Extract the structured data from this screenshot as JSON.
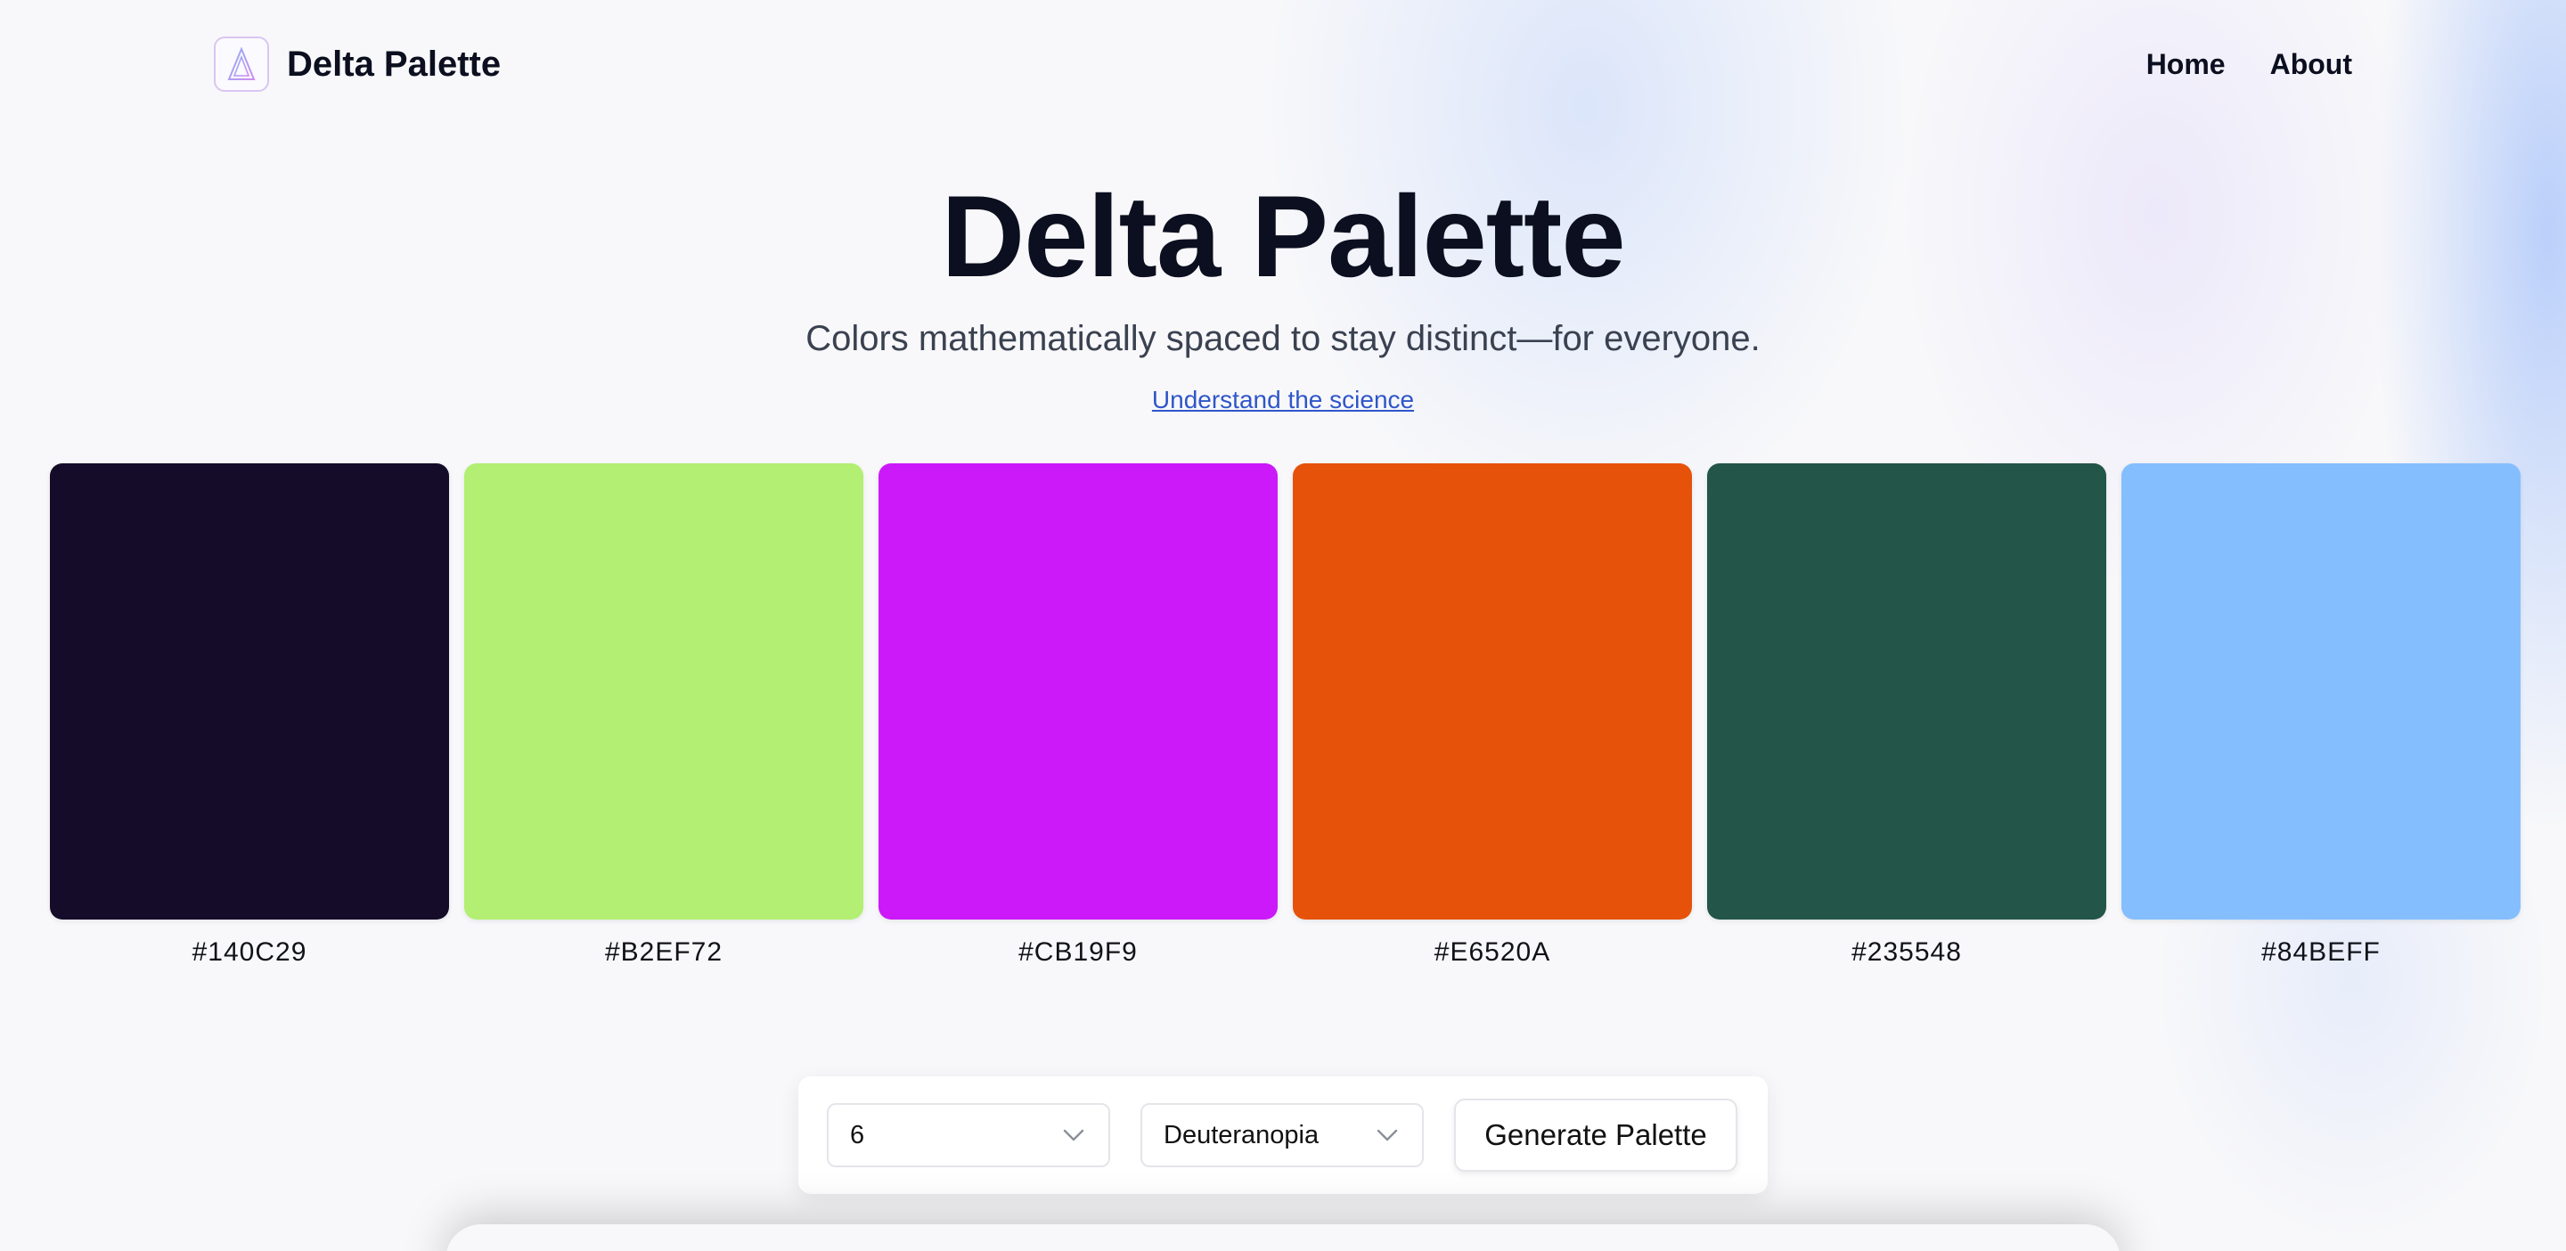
{
  "header": {
    "brand_name": "Delta Palette",
    "logo_icon": "delta-triangle-icon",
    "nav": [
      {
        "label": "Home"
      },
      {
        "label": "About"
      }
    ]
  },
  "hero": {
    "title": "Delta Palette",
    "subtitle": "Colors mathematically spaced to stay distinct—for everyone.",
    "link_label": "Understand the science"
  },
  "swatches": [
    {
      "hex": "#140C29"
    },
    {
      "hex": "#B2EF72"
    },
    {
      "hex": "#CB19F9"
    },
    {
      "hex": "#E6520A"
    },
    {
      "hex": "#235548"
    },
    {
      "hex": "#84BEFF"
    }
  ],
  "controls": {
    "count_select": {
      "value": "6"
    },
    "vision_select": {
      "value": "Deuteranopia"
    },
    "generate_label": "Generate Palette"
  },
  "colors": {
    "link": "#2F56C9",
    "logo_border": "#D9C6F2",
    "text": "#0B0F1F"
  }
}
